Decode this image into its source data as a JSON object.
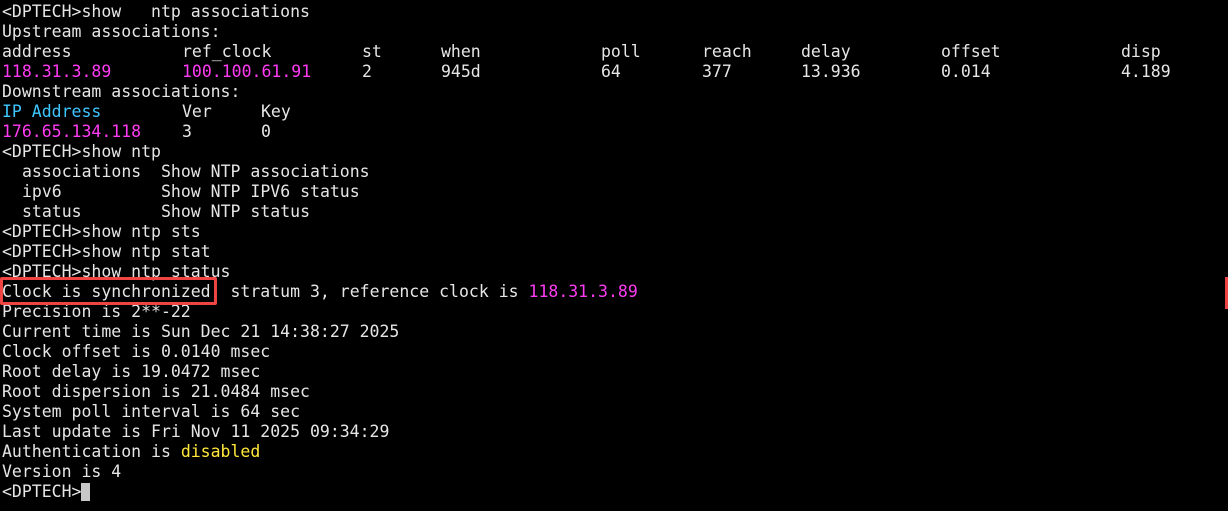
{
  "upstream": {
    "cmd": "<DPTECH>show   ntp associations",
    "title": "Upstream associations:",
    "headers": [
      "address",
      "ref_clock",
      "st",
      "when",
      "poll",
      "reach",
      "delay",
      "offset",
      "disp"
    ],
    "row": [
      "118.31.3.89",
      "100.100.61.91",
      "2",
      "945d",
      "64",
      "377",
      "13.936",
      "0.014",
      "4.189"
    ]
  },
  "downstream": {
    "title": "Downstream associations:",
    "headers": [
      "IP Address",
      "Ver",
      "Key"
    ],
    "row": [
      "176.65.134.118",
      "3",
      "0"
    ]
  },
  "help": {
    "cmd": "<DPTECH>show ntp",
    "items": [
      {
        "name": "associations",
        "desc": "Show NTP associations"
      },
      {
        "name": "ipv6",
        "desc": "Show NTP IPV6 status"
      },
      {
        "name": "status",
        "desc": "Show NTP status"
      }
    ]
  },
  "cmds": {
    "sts": "<DPTECH>show ntp sts",
    "stat": "<DPTECH>show ntp stat",
    "status": "<DPTECH>show ntp status"
  },
  "status": {
    "clock_sync": "Clock is synchronized",
    "stratum_text": ", stratum 3, reference clock is ",
    "reference_clock": "118.31.3.89",
    "precision": "Precision is 2**-22",
    "current_time": "Current time is Sun Dec 21 14:38:27 2025",
    "clock_offset": "Clock offset is 0.0140 msec",
    "root_delay": "Root delay is 19.0472 msec",
    "root_dispersion": "Root dispersion is 21.0484 msec",
    "poll_interval": "System poll interval is 64 sec",
    "last_update": "Last update is Fri Nov 11 2025 09:34:29",
    "auth_label": "Authentication is ",
    "auth_value": "disabled",
    "version": "Version is 4"
  },
  "prompt": "<DPTECH>",
  "colors": {
    "background": "#000000",
    "text": "#e6e6e6",
    "magenta": "#ff3cf3",
    "cyan": "#3ec7ff",
    "yellow": "#ffe93a",
    "highlight": "#ee4444"
  }
}
